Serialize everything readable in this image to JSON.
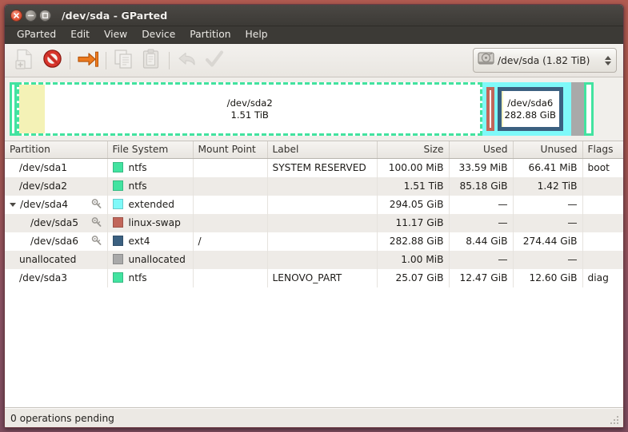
{
  "window": {
    "title": "/dev/sda - GParted",
    "buttons": [
      {
        "name": "close",
        "icon": "close-icon"
      },
      {
        "name": "minimize",
        "icon": "minimize-icon"
      },
      {
        "name": "maximize",
        "icon": "maximize-icon"
      }
    ]
  },
  "menubar": {
    "items": [
      {
        "label": "GParted"
      },
      {
        "label": "Edit"
      },
      {
        "label": "View"
      },
      {
        "label": "Device"
      },
      {
        "label": "Partition"
      },
      {
        "label": "Help"
      }
    ]
  },
  "toolbar": {
    "buttons": [
      {
        "name": "new-partition-button",
        "icon": "new-document-icon",
        "enabled": false
      },
      {
        "name": "delete-partition-button",
        "icon": "delete-forbidden-icon",
        "enabled": true
      },
      {
        "name": "resize-move-button",
        "icon": "resize-arrow-icon",
        "enabled": true
      },
      {
        "name": "copy-button",
        "icon": "copy-icon",
        "enabled": false
      },
      {
        "name": "paste-button",
        "icon": "paste-clipboard-icon",
        "enabled": false
      },
      {
        "name": "undo-button",
        "icon": "undo-arrow-icon",
        "enabled": false
      },
      {
        "name": "apply-button",
        "icon": "apply-checkmark-icon",
        "enabled": false
      }
    ],
    "device_selector": {
      "icon": "harddisk-icon",
      "value": "/dev/sda  (1.82 TiB)"
    }
  },
  "graphic": {
    "blocks": [
      {
        "name": "/dev/sda1",
        "label": "",
        "size_label": "",
        "width_pct": 1.2,
        "border_color": "#42e3a0",
        "fill_color": "#ffffff",
        "used_pct": 0,
        "used_color": "#f2f0b4",
        "selected": false,
        "show_text": false
      },
      {
        "name": "/dev/sda2",
        "label": "/dev/sda2",
        "size_label": "1.51 TiB",
        "width_pct": 76.5,
        "border_color": "#42e3a0",
        "fill_color": "#ffffff",
        "used_pct": 5.6,
        "used_color": "#f4f2b6",
        "selected": true,
        "show_text": true
      },
      {
        "name": "/dev/sda4",
        "label": "",
        "size_label": "",
        "width_pct": 14.6,
        "border_color": "#7ff9f9",
        "fill_color": "#7ff9f9",
        "used_pct": 0,
        "used_color": "#7ff9f9",
        "selected": false,
        "show_text": false,
        "children": [
          {
            "name": "/dev/sda5",
            "label": "",
            "size_label": "",
            "width_pct": 9,
            "border_color": "#c1665a",
            "fill_color": "#ffffff",
            "used_pct": 0,
            "used_color": "#ffffff",
            "selected": false,
            "show_text": false
          },
          {
            "name": "/dev/sda6",
            "label": "/dev/sda6",
            "size_label": "282.88 GiB",
            "width_pct": 78,
            "border_color": "#3b6080",
            "fill_color": "#ffffff",
            "used_pct": 3,
            "used_color": "#f6f4c0",
            "selected": true,
            "show_text": true
          }
        ]
      },
      {
        "name": "unallocated",
        "label": "",
        "size_label": "",
        "width_pct": 2.0,
        "border_color": "#a9a9a9",
        "fill_color": "#a9a9a9",
        "used_pct": 0,
        "used_color": "#a9a9a9",
        "selected": false,
        "show_text": false
      },
      {
        "name": "/dev/sda3",
        "label": "",
        "size_label": "",
        "width_pct": 1.6,
        "border_color": "#42e3a0",
        "fill_color": "#ffffff",
        "used_pct": 0,
        "used_color": "#f2f0b4",
        "selected": false,
        "show_text": false
      }
    ]
  },
  "table": {
    "headers": [
      {
        "label": "Partition",
        "align": "left"
      },
      {
        "label": "File System",
        "align": "left"
      },
      {
        "label": "Mount Point",
        "align": "left"
      },
      {
        "label": "Label",
        "align": "left"
      },
      {
        "label": "Size",
        "align": "right"
      },
      {
        "label": "Used",
        "align": "right"
      },
      {
        "label": "Unused",
        "align": "right"
      },
      {
        "label": "Flags",
        "align": "left"
      }
    ],
    "rows": [
      {
        "partition": "/dev/sda1",
        "indent": 0,
        "expander": "",
        "key_icon": false,
        "fs": "ntfs",
        "fs_color": "#42e3a0",
        "mount": "",
        "fslabel": "SYSTEM RESERVED",
        "size": "100.00 MiB",
        "used": "33.59 MiB",
        "unused": "66.41 MiB",
        "flags": "boot",
        "alt": false
      },
      {
        "partition": "/dev/sda2",
        "indent": 0,
        "expander": "",
        "key_icon": false,
        "fs": "ntfs",
        "fs_color": "#42e3a0",
        "mount": "",
        "fslabel": "",
        "size": "1.51 TiB",
        "used": "85.18 GiB",
        "unused": "1.42 TiB",
        "flags": "",
        "alt": true
      },
      {
        "partition": "/dev/sda4",
        "indent": 0,
        "expander": "open",
        "key_icon": true,
        "fs": "extended",
        "fs_color": "#7ff9f9",
        "mount": "",
        "fslabel": "",
        "size": "294.05 GiB",
        "used": "—",
        "unused": "—",
        "flags": "",
        "alt": false
      },
      {
        "partition": "/dev/sda5",
        "indent": 1,
        "expander": "",
        "key_icon": true,
        "fs": "linux-swap",
        "fs_color": "#c1665a",
        "mount": "",
        "fslabel": "",
        "size": "11.17 GiB",
        "used": "—",
        "unused": "—",
        "flags": "",
        "alt": true
      },
      {
        "partition": "/dev/sda6",
        "indent": 1,
        "expander": "",
        "key_icon": true,
        "fs": "ext4",
        "fs_color": "#3b6080",
        "mount": "/",
        "fslabel": "",
        "size": "282.88 GiB",
        "used": "8.44 GiB",
        "unused": "274.44 GiB",
        "flags": "",
        "alt": false
      },
      {
        "partition": "unallocated",
        "indent": 0,
        "expander": "",
        "key_icon": false,
        "fs": "unallocated",
        "fs_color": "#a9a9a9",
        "mount": "",
        "fslabel": "",
        "size": "1.00 MiB",
        "used": "—",
        "unused": "—",
        "flags": "",
        "alt": true
      },
      {
        "partition": "/dev/sda3",
        "indent": 0,
        "expander": "",
        "key_icon": false,
        "fs": "ntfs",
        "fs_color": "#42e3a0",
        "mount": "",
        "fslabel": "LENOVO_PART",
        "size": "25.07 GiB",
        "used": "12.47 GiB",
        "unused": "12.60 GiB",
        "flags": "diag",
        "alt": false
      }
    ]
  },
  "statusbar": {
    "text": "0 operations pending",
    "grip_icon": "resize-grip-icon"
  }
}
